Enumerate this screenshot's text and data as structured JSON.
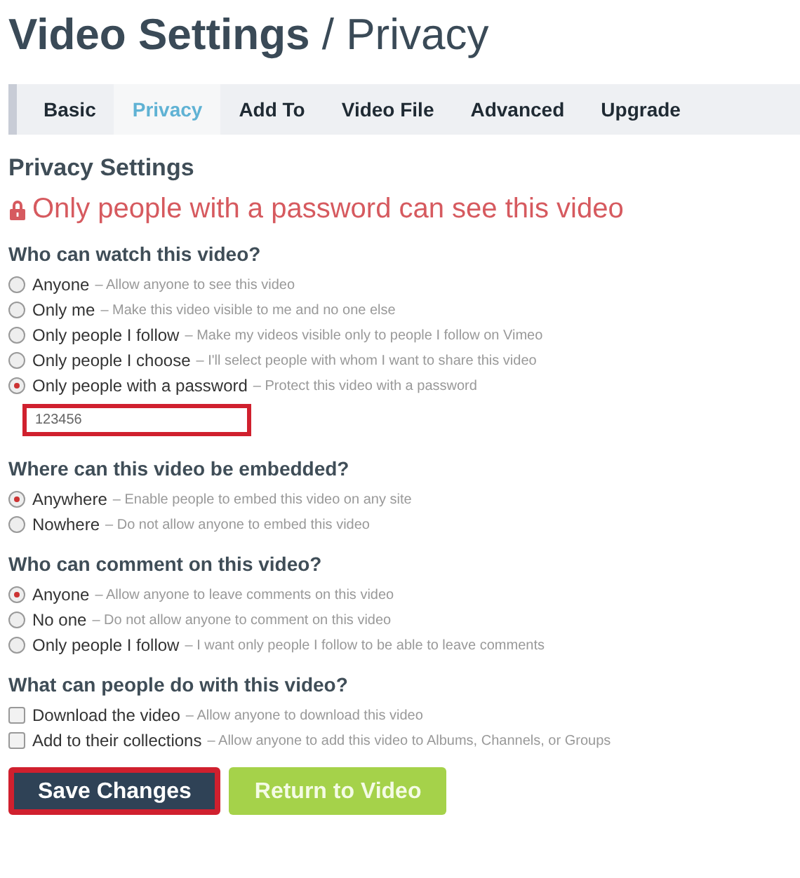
{
  "page_title": "**Video Settings** / Privacy",
  "tabs": [
    {
      "label": "Basic",
      "selected": false
    },
    {
      "label": "Privacy",
      "selected": true
    },
    {
      "label": "Add To",
      "selected": false
    },
    {
      "label": "Video File",
      "selected": false
    },
    {
      "label": "Advanced",
      "selected": false
    },
    {
      "label": "Upgrade",
      "selected": false
    }
  ],
  "section_title": "Privacy Settings",
  "notice": "Only people with a password can see this video",
  "groups": [
    {
      "question": "Who can watch this video?",
      "kind": "radio",
      "options": [
        {
          "label": "Anyone",
          "hint": "– Allow anyone to see this video",
          "selected": false
        },
        {
          "label": "Only me",
          "hint": "– Make this video visible to me and no one else",
          "selected": false
        },
        {
          "label": "Only people I follow",
          "hint": "– Make my videos visible only to people I follow on Vimeo",
          "selected": false
        },
        {
          "label": "Only people I choose",
          "hint": "– I'll select people with whom I want to share this video",
          "selected": false
        },
        {
          "label": "Only people with a password",
          "hint": "– Protect this video with a password",
          "selected": true
        }
      ],
      "password": {
        "value": "123456",
        "highlighted": true
      }
    },
    {
      "question": "Where can this video be embedded?",
      "kind": "radio",
      "options": [
        {
          "label": "Anywhere",
          "hint": "– Enable people to embed this video on any site",
          "selected": true
        },
        {
          "label": "Nowhere",
          "hint": "– Do not allow anyone to embed this video",
          "selected": false
        }
      ]
    },
    {
      "question": "Who can comment on this video?",
      "kind": "radio",
      "options": [
        {
          "label": "Anyone",
          "hint": "– Allow anyone to leave comments on this video",
          "selected": true
        },
        {
          "label": "No one",
          "hint": "– Do not allow anyone to comment on this video",
          "selected": false
        },
        {
          "label": "Only people I follow",
          "hint": "– I want only people I follow to be able to leave comments",
          "selected": false
        }
      ]
    },
    {
      "question": "What can people do with this video?",
      "kind": "checkbox",
      "options": [
        {
          "label": "Download the video",
          "hint": "– Allow anyone to download this video",
          "checked": false
        },
        {
          "label": "Add to their collections",
          "hint": "– Allow anyone to add this video to Albums, Channels, or Groups",
          "checked": false
        }
      ]
    }
  ],
  "buttons": [
    {
      "label": "Save Changes",
      "kind": "primary",
      "highlighted": true
    },
    {
      "label": "Return to Video",
      "kind": "secondary",
      "highlighted": false
    }
  ]
}
